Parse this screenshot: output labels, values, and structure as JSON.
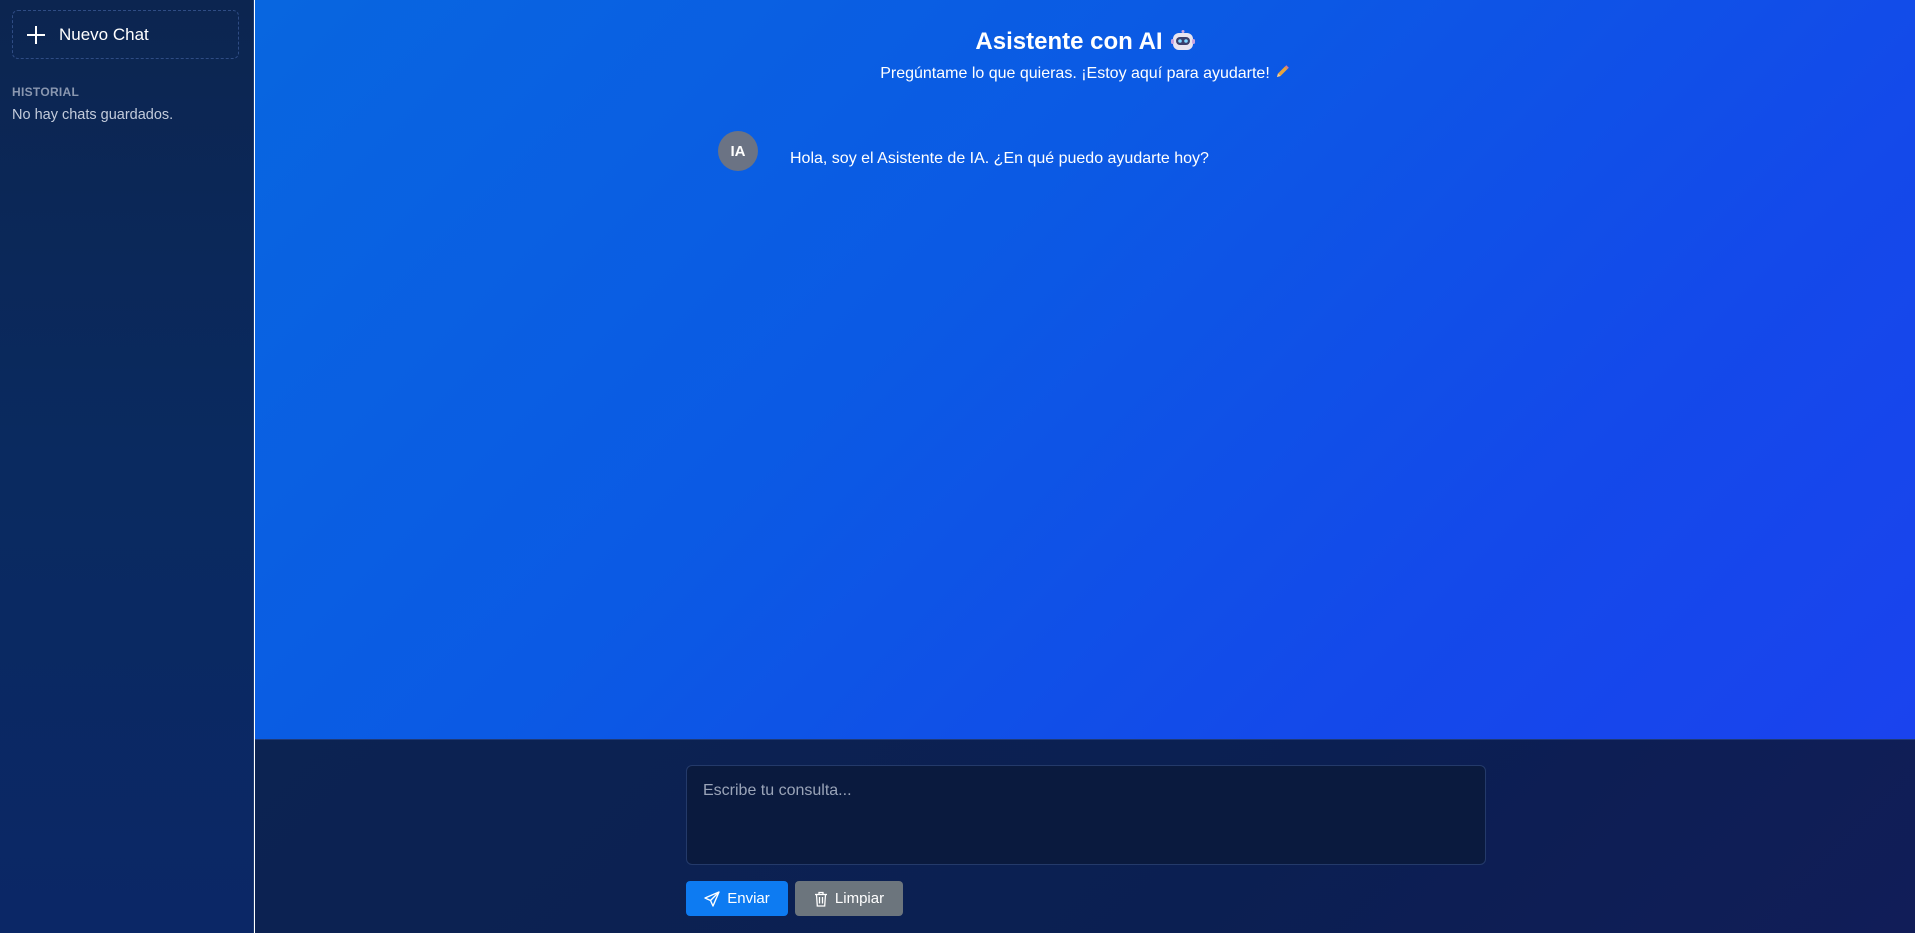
{
  "sidebar": {
    "new_chat_label": "Nuevo Chat",
    "history_title": "HISTORIAL",
    "history_empty": "No hay chats guardados."
  },
  "header": {
    "title": "Asistente con AI",
    "subtitle": "Pregúntame lo que quieras. ¡Estoy aquí para ayudarte!",
    "title_icon": "robot-icon",
    "subtitle_icon": "pencil-icon"
  },
  "messages": [
    {
      "avatar": "IA",
      "text": "Hola, soy el Asistente de IA. ¿En qué puedo ayudarte hoy?"
    }
  ],
  "composer": {
    "placeholder": "Escribe tu consulta...",
    "send_label": "Enviar",
    "clear_label": "Limpiar",
    "send_icon": "paper-plane-icon",
    "clear_icon": "trash-icon"
  },
  "colors": {
    "accent": "#0d7bf2",
    "secondary_button": "#6c757d",
    "main_gradient_start": "#0866e0",
    "main_gradient_end": "#1a43ee",
    "sidebar_bg": "#0b2766"
  }
}
